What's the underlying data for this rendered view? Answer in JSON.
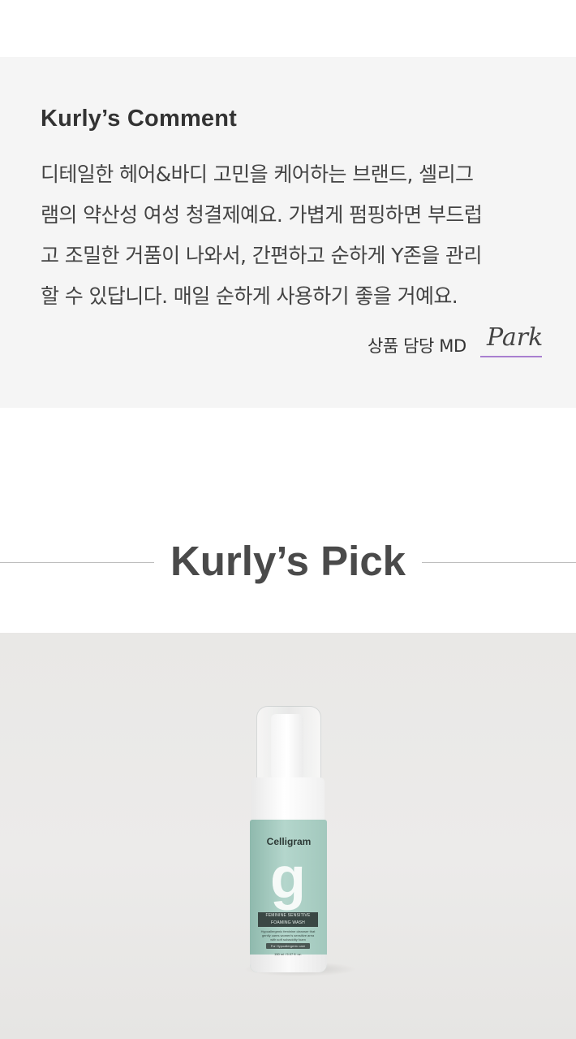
{
  "comment": {
    "title": "Kurly’s Comment",
    "lines": [
      "디테일한 헤어&바디 고민을 케어하는 브랜드, 셀리그",
      "램의 약산성 여성 청결제예요. 가볍게 펌핑하면 부드럽",
      "고 조밀한 거품이 나와서, 간편하고 순하게 Y존을 관리",
      "할 수 있답니다. 매일 순하게 사용하기 좋을 거예요."
    ],
    "md_label": "상품 담당 MD",
    "md_signature": "Park"
  },
  "pick": {
    "title": "Kurly’s Pick"
  },
  "product": {
    "brand": "Celligram",
    "logo_letter": "g",
    "label_line1": "FEMININE SENSITIVE",
    "label_line2": "FOAMING WASH",
    "description": "Hypoallergenic feminine cleanser that gently cares women's sensitive area with soft subacidity foam",
    "pill_text": "For Hypoallergenic care",
    "volume": "150 ml / 5.07 fl. oz.",
    "colors": {
      "bottle": "#a2c8bd",
      "band": "#3a4744"
    }
  }
}
